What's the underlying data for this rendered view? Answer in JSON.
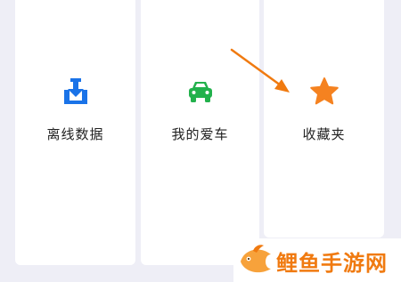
{
  "tiles": [
    {
      "label": "离线数据",
      "icon": "download-box-icon",
      "color": "#1a73e8"
    },
    {
      "label": "我的爱车",
      "icon": "car-icon",
      "color": "#22b14c"
    },
    {
      "label": "收藏夹",
      "icon": "star-icon",
      "color": "#f58220"
    }
  ],
  "annotation": {
    "icon": "pointer-arrow-icon",
    "color": "#f07a10"
  },
  "watermark": {
    "text": "鲤鱼手游网",
    "icon": "fish-logo-icon",
    "color": "#f07a10"
  }
}
